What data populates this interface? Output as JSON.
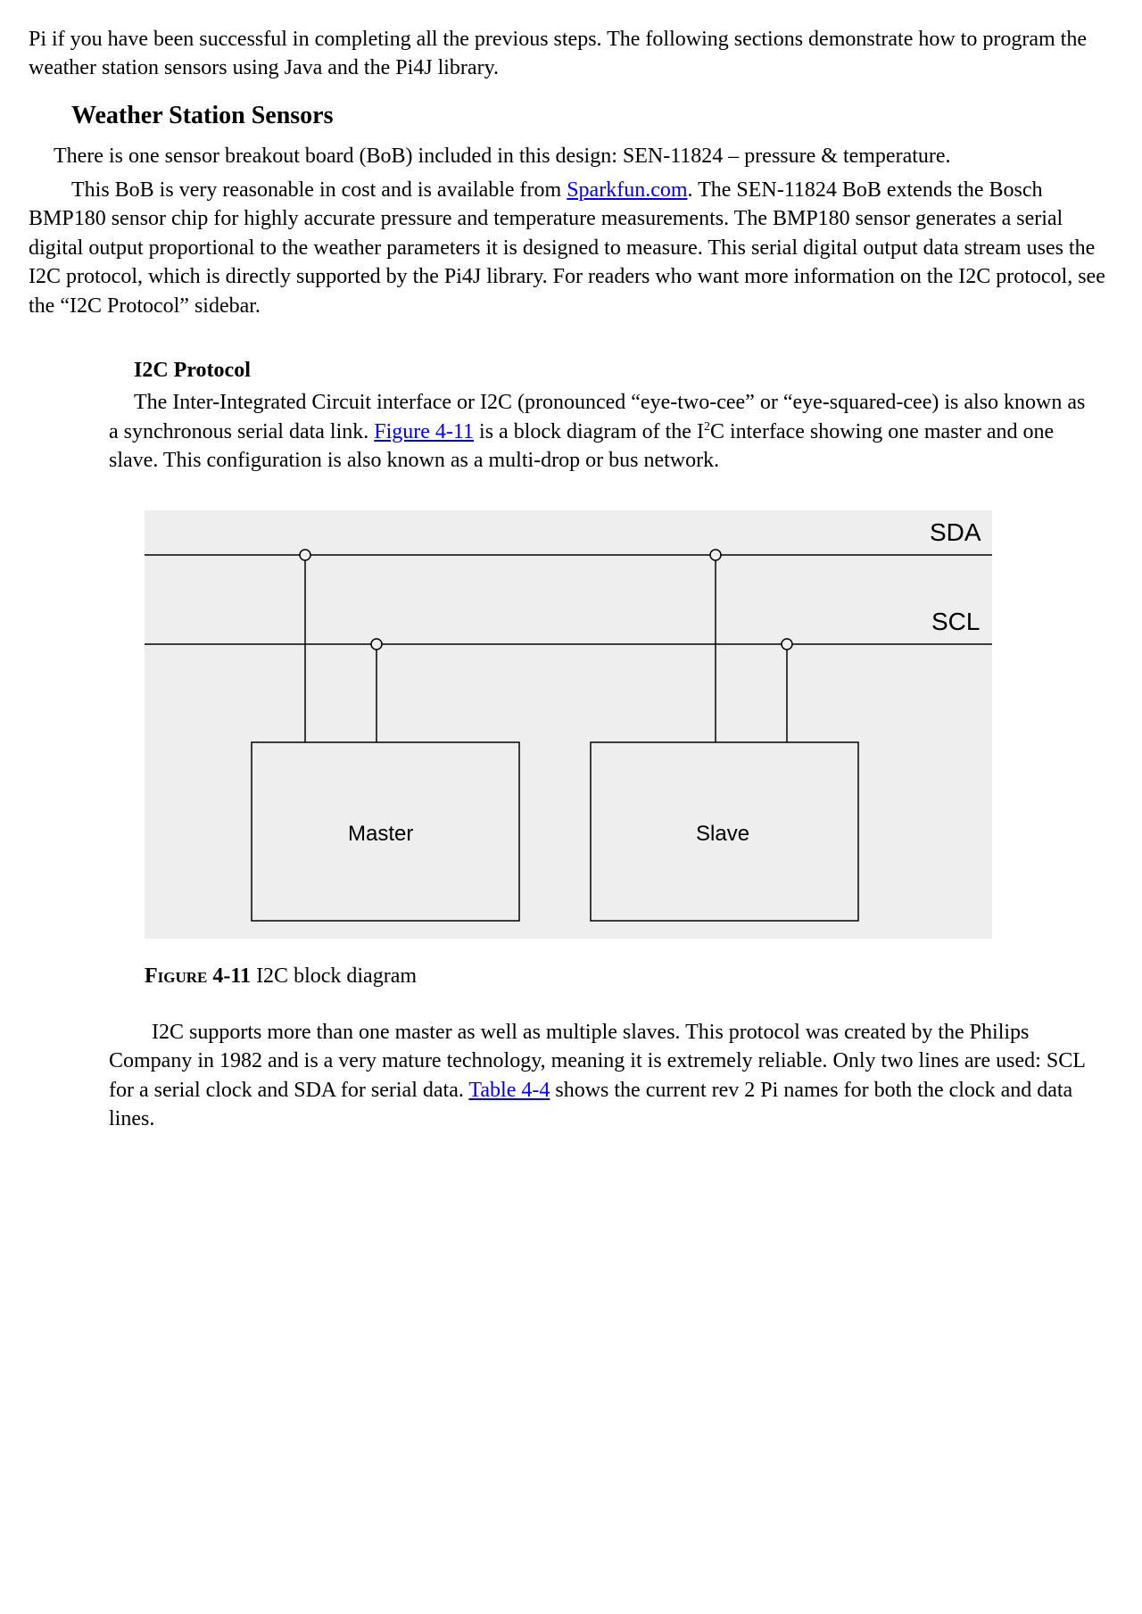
{
  "intro": {
    "para1": "Pi if you have been successful in completing all the previous steps. The following sections demonstrate how to program the weather station sensors using Java and the Pi4J library."
  },
  "section": {
    "heading": "Weather Station Sensors",
    "para1": "There is one sensor breakout board (BoB) included in this design: SEN-11824 – pressure & temperature.",
    "para2_a": "This BoB is very reasonable in cost and is available from ",
    "para2_link": "Sparkfun.com",
    "para2_b": ". The SEN-11824 BoB extends the Bosch BMP180 sensor chip for highly accurate pressure and temperature measurements. The BMP180 sensor generates a serial digital output proportional to the weather parameters it is designed to measure. This serial digital output data stream uses the I2C protocol, which is directly supported by the Pi4J library. For readers who want more information on the I2C protocol, see the “I2C Protocol” sidebar."
  },
  "sidebar": {
    "heading": "I2C Protocol",
    "para1_a": "The Inter-Integrated Circuit interface or I2C (pronounced “eye-two-cee” or “eye-squared-cee) is also known as a synchronous serial data link. ",
    "para1_link": "Figure 4-11",
    "para1_b": " is a block diagram of the I",
    "para1_sup": "2",
    "para1_c": "C interface showing one master and one slave. This configuration is also known as a multi-drop or bus network.",
    "para2_a": "I2C supports more than one master as well as multiple slaves. This protocol was created by the Philips Company in 1982 and is a very mature technology, meaning it is extremely reliable. Only two lines are used: SCL for a serial clock and SDA for serial data. ",
    "para2_link": "Table 4-4",
    "para2_b": " shows the current rev 2 Pi names for both the clock and data lines."
  },
  "figure": {
    "label": "Figure 4-11",
    "caption": " I2C block diagram",
    "sda_label": "SDA",
    "scl_label": "SCL",
    "master_label": "Master",
    "slave_label": "Slave"
  }
}
